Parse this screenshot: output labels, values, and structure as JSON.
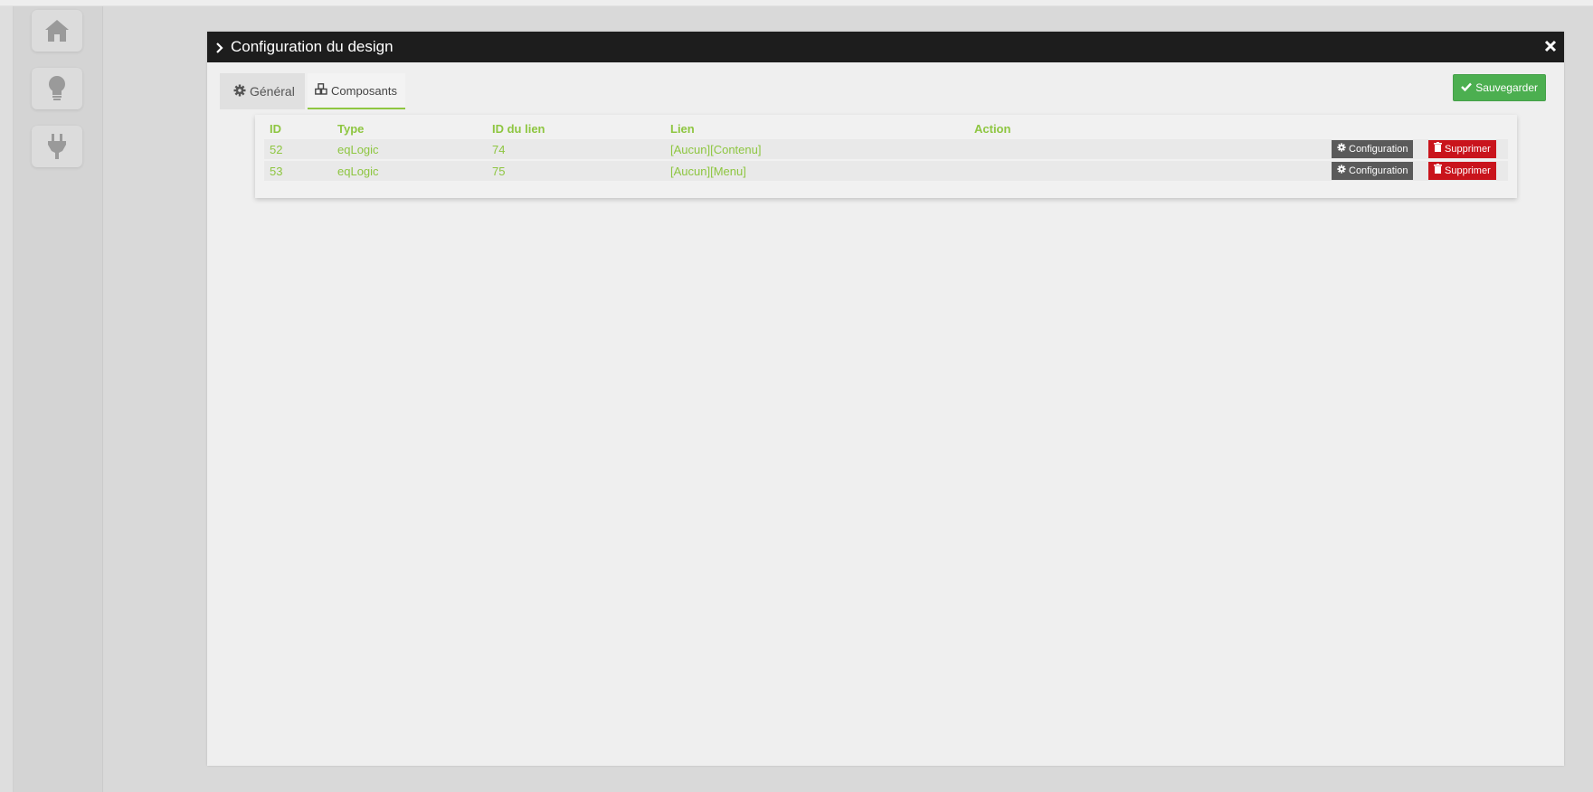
{
  "modal": {
    "title": "Configuration du design"
  },
  "tabs": [
    {
      "label": "Général"
    },
    {
      "label": "Composants"
    }
  ],
  "actions": {
    "save_label": "Sauvegarder"
  },
  "table": {
    "headers": [
      "ID",
      "Type",
      "ID du lien",
      "Lien",
      "Action"
    ],
    "rows": [
      {
        "id": "52",
        "type": "eqLogic",
        "link_id": "74",
        "link": "[Aucun][Contenu]",
        "config_label": "Configuration",
        "delete_label": "Supprimer"
      },
      {
        "id": "53",
        "type": "eqLogic",
        "link_id": "75",
        "link": "[Aucun][Menu]",
        "config_label": "Configuration",
        "delete_label": "Supprimer"
      }
    ]
  },
  "colors": {
    "accent_green": "#8ec641",
    "save_green": "#4caf50",
    "delete_red": "#c9141c",
    "header_dark": "#1d1d1d"
  },
  "icons": [
    "home-icon",
    "lightbulb-icon",
    "plug-icon",
    "chevron-right-icon",
    "close-icon",
    "gear-icon",
    "cubes-icon",
    "check-icon",
    "trash-icon"
  ]
}
